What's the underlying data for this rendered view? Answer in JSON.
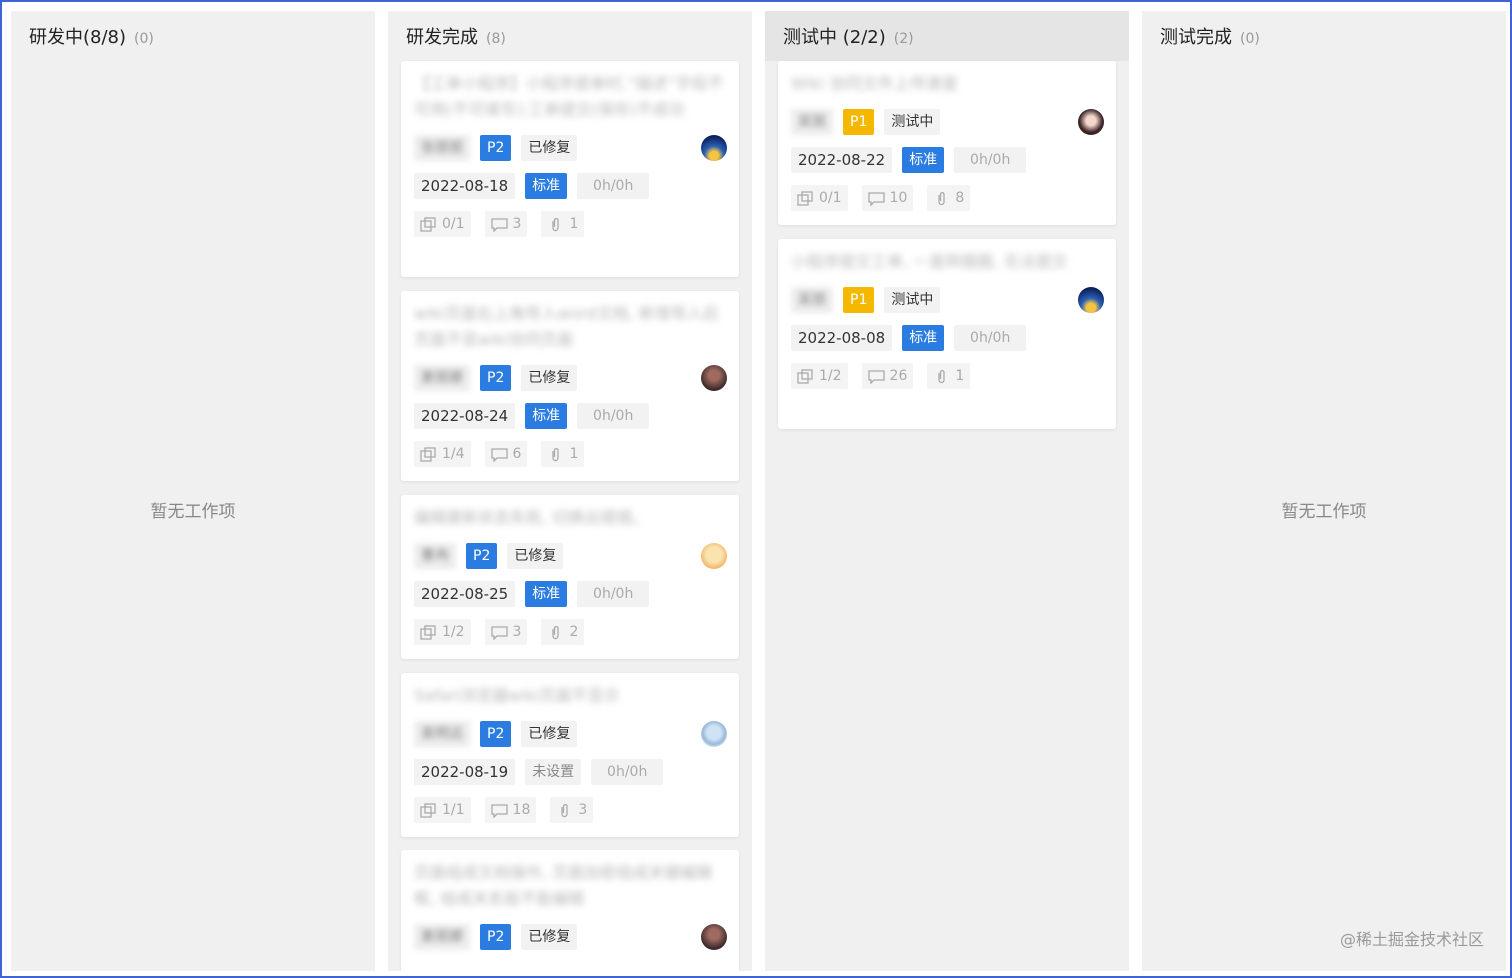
{
  "columns": [
    {
      "title": "研发中(8/8)",
      "count": "(0)",
      "empty_text": "暂无工作项"
    },
    {
      "title": "研发完成",
      "count": "(8)"
    },
    {
      "title": "测试中 (2/2)",
      "count": "(2)"
    },
    {
      "title": "测试完成",
      "count": "(0)",
      "empty_text": "暂无工作项"
    }
  ],
  "cards_dev_done": [
    {
      "title": "【工单小程序】小程序提单时,“描述”字段不可用(不可填写):工单提交(保存)不成功",
      "assignee": "张丽丽",
      "priority": "P2",
      "status": "已修复",
      "avatar": "avatar-blue",
      "date": "2022-08-18",
      "type": "标准",
      "time": "0h/0h",
      "subtasks": "0/1",
      "comments": "3",
      "attachments": "1"
    },
    {
      "title": "wiki页面右上角导入word文档, 新增导入后页面不显wiki协同页面",
      "assignee": "姜丽娜",
      "priority": "P2",
      "status": "已修复",
      "avatar": "avatar-dark",
      "date": "2022-08-24",
      "type": "标准",
      "time": "0h/0h",
      "subtasks": "1/4",
      "comments": "6",
      "attachments": "1"
    },
    {
      "title": "编辑建新状态失败, 切换出错错。",
      "assignee": "曹冉",
      "priority": "P2",
      "status": "已修复",
      "avatar": "avatar-anime",
      "date": "2022-08-25",
      "type": "标准",
      "time": "0h/0h",
      "subtasks": "1/2",
      "comments": "3",
      "attachments": "2"
    },
    {
      "title": "Safari浏览器wiki页面不显示",
      "assignee": "袁明远",
      "priority": "P2",
      "status": "已修复",
      "avatar": "avatar-light",
      "date": "2022-08-19",
      "type": "未设置",
      "time": "0h/0h",
      "subtasks": "1/1",
      "comments": "18",
      "attachments": "3"
    },
    {
      "title": "页面组成文档操作, 页面加密组成关键编辑框, 组成关系能不能编辑",
      "assignee": "姜丽娜",
      "priority": "P2",
      "status": "已修复",
      "avatar": "avatar-dark"
    }
  ],
  "cards_testing": [
    {
      "title": "Wiki 协同文件上传速度",
      "assignee": "吴丽",
      "priority": "P1",
      "status": "测试中",
      "avatar": "avatar-girl",
      "date": "2022-08-22",
      "type": "标准",
      "time": "0h/0h",
      "subtasks": "0/1",
      "comments": "10",
      "attachments": "8"
    },
    {
      "title": "小程序提交工单, 一直转圈圈, 无法提交",
      "assignee": "吴丽",
      "priority": "P1",
      "status": "测试中",
      "avatar": "avatar-blue",
      "date": "2022-08-08",
      "type": "标准",
      "time": "0h/0h",
      "subtasks": "1/2",
      "comments": "26",
      "attachments": "1"
    }
  ],
  "watermark": "@稀土掘金技术社区",
  "colors": {
    "blue_tag": "#2a7ce0",
    "yellow_tag": "#f5b800",
    "column_bg": "#f0f0f0",
    "frame_border": "#3f64d6"
  }
}
